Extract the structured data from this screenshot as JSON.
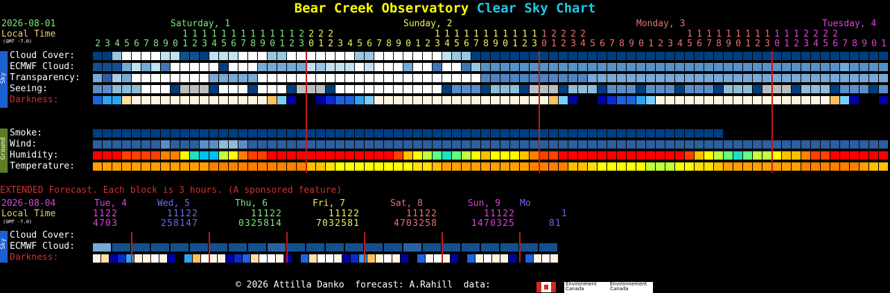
{
  "header": {
    "title_part1": "Bear Creek Observatory",
    "title_part2": "Clear Sky Chart",
    "title_color1": "#ffff00",
    "title_color2": "#1fc8e8",
    "date": "2026-08-01",
    "local_time_label": "Local Time",
    "gmt_label": "(GMT -7.0)",
    "days": [
      {
        "label": "Saturday, 1",
        "color": "#7ee87e"
      },
      {
        "label": "Sunday, 2",
        "color": "#f0f060"
      },
      {
        "label": "Monday, 3",
        "color": "#f07070"
      },
      {
        "label": "Tuesday, 4",
        "color": "#e040e0"
      }
    ]
  },
  "rows": {
    "sky_label": "Sky",
    "ground_label": "Ground",
    "cloud_cover": "Cloud Cover:",
    "ecmwf_cloud": "ECMWF Cloud:",
    "transparency": "Transparency:",
    "seeing": "Seeing:",
    "darkness": "Darkness:",
    "smoke": "Smoke:",
    "wind": "Wind:",
    "humidity": "Humidity:",
    "temperature": "Temperature:"
  },
  "extended": {
    "banner": "EXTENDED Forecast. Each block is 3 hours. (A sponsored feature)",
    "date": "2026-08-04",
    "local_time_label": "Local Time",
    "gmt_label": "(GMT -7.0)",
    "days": [
      {
        "label": "Tue, 4",
        "color": "#e040e0",
        "tens": "1122 ",
        "ones": "4703"
      },
      {
        "label": "Wed, 5",
        "color": "#6a6af0",
        "tens": " 11122",
        "ones": "258147"
      },
      {
        "label": "Thu, 6",
        "color": "#7ee87e",
        "tens": "  11122",
        "ones": "0325814"
      },
      {
        "label": "Fri, 7",
        "color": "#f0f060",
        "tens": "  11122",
        "ones": "7032581"
      },
      {
        "label": "Sat, 8",
        "color": "#f07070",
        "tens": "  11122",
        "ones": "4703258"
      },
      {
        "label": "Sun, 9",
        "color": "#e040e0",
        "tens": "  11122",
        "ones": "1470325"
      },
      {
        "label": "Mo",
        "color": "#6a6af0",
        "tens": "  1",
        "ones": "81"
      }
    ],
    "cloud_cover": "Cloud Cover:",
    "ecmwf_cloud": "ECMWF Cloud:",
    "darkness": "Darkness:"
  },
  "footer": {
    "text": "© 2026 Attilla Danko  forecast: A.Rahill  data:",
    "env_line1": "Environment",
    "env_line2": "Canada",
    "env_line3": "Environnement",
    "env_line4": "Canada"
  },
  "chart_data": {
    "type": "heatmap",
    "title": "Bear Creek Observatory Clear Sky Chart",
    "start_hour": 2,
    "hour_tens": "         1111111111112222          1111111111112222          1111111111112222          11",
    "hour_ones": "23456789012345678901230123456789012345678901230123456789012345678901230123456789012345678901",
    "palette": {
      "cloud": [
        "#003f7f",
        "#13508d",
        "#2a62a0",
        "#4077b4",
        "#5891c6",
        "#75aad6",
        "#9ac6e0",
        "#c2e2f0",
        "#ffffff"
      ],
      "transparency": [
        "#003f7f",
        "#2c5ea0",
        "#4d84c0",
        "#79a9d6",
        "#a8cce8",
        "#d6ecf6",
        "#ffffff"
      ],
      "seeing": [
        "#003f7f",
        "#2c5ea0",
        "#5a8dc8",
        "#8fbcd8",
        "#bdbdbd",
        "#ffffff"
      ],
      "darkness": [
        "#000000",
        "#0000a0",
        "#0a2ad0",
        "#1e62e0",
        "#2fa4f0",
        "#78d0ff",
        "#ffe0a0",
        "#ffc060",
        "#fff4e0",
        "#ffffff"
      ],
      "smoke": [
        "#003f7f"
      ],
      "wind": [
        "#003f7f",
        "#2c5ea0",
        "#5a8dc8",
        "#8fbcd8"
      ],
      "humidity": [
        "#ff0000",
        "#ff4000",
        "#ff8000",
        "#ffc000",
        "#ffff00",
        "#c0ff40",
        "#60ff80",
        "#20e0c0",
        "#00c0ff"
      ],
      "temperature": [
        "#ff6000",
        "#ff8000",
        "#ffa000",
        "#ffc000",
        "#ffe000",
        "#ffff00",
        "#c0ff40",
        "#80ff60"
      ]
    },
    "series": {
      "cloud_cover": [
        0,
        0,
        6,
        8,
        8,
        8,
        8,
        7,
        7,
        1,
        1,
        0,
        7,
        7,
        7,
        8,
        8,
        8,
        6,
        6,
        8,
        8,
        8,
        8,
        8,
        8,
        8,
        6,
        6,
        8,
        8,
        8,
        8,
        8,
        8,
        8,
        7,
        6,
        6,
        0,
        0,
        0,
        0,
        0,
        0,
        0,
        0,
        0,
        0,
        0,
        0,
        0,
        0,
        0,
        0,
        0,
        0,
        0,
        0,
        0,
        0,
        0,
        0,
        0,
        0,
        0,
        0,
        0,
        0,
        0,
        0,
        0,
        0,
        0,
        0,
        0,
        0,
        0,
        0,
        0,
        0,
        0,
        0,
        0,
        0,
        0,
        0,
        0,
        0,
        0,
        0
      ],
      "ecmwf_cloud": [
        1,
        1,
        1,
        5,
        7,
        5,
        7,
        3,
        8,
        8,
        8,
        8,
        8,
        0,
        8,
        8,
        8,
        5,
        5,
        5,
        5,
        5,
        7,
        6,
        7,
        7,
        7,
        8,
        7,
        8,
        8,
        8,
        5,
        8,
        8,
        3,
        8,
        8,
        3,
        6,
        4,
        4,
        4,
        4,
        4,
        4,
        4,
        4,
        4,
        4,
        4,
        4,
        4,
        4,
        4,
        4,
        4,
        4,
        4,
        4,
        4,
        4,
        4,
        4,
        4,
        4,
        4,
        4,
        4,
        4,
        4,
        4,
        4,
        4,
        4,
        4,
        4,
        5,
        4,
        4,
        4,
        4,
        4,
        4,
        4,
        4,
        4,
        4,
        4,
        4,
        3
      ],
      "transparency": [
        3,
        1,
        4,
        3,
        6,
        6,
        6,
        6,
        6,
        6,
        6,
        6,
        3,
        3,
        3,
        3,
        3,
        6,
        6,
        6,
        6,
        6,
        6,
        6,
        6,
        6,
        6,
        6,
        6,
        6,
        6,
        6,
        6,
        6,
        6,
        6,
        6,
        6,
        6,
        6,
        2,
        2,
        2,
        2,
        2,
        2,
        2,
        2,
        2,
        2,
        2,
        3,
        3,
        3,
        3,
        3,
        3,
        3,
        3,
        3,
        3,
        3,
        3,
        3,
        3,
        3,
        3,
        3,
        3,
        3,
        3,
        3,
        3,
        3,
        3,
        3,
        3,
        3,
        3,
        3,
        3,
        3,
        3,
        3,
        3,
        3,
        3,
        3,
        3,
        3,
        3
      ],
      "seeing": [
        2,
        2,
        3,
        3,
        3,
        5,
        5,
        5,
        0,
        4,
        4,
        4,
        0,
        5,
        5,
        5,
        0,
        5,
        5,
        5,
        0,
        4,
        4,
        4,
        0,
        5,
        5,
        5,
        5,
        5,
        5,
        5,
        5,
        5,
        5,
        5,
        0,
        2,
        2,
        2,
        0,
        3,
        3,
        3,
        0,
        4,
        4,
        4,
        0,
        3,
        3,
        3,
        0,
        2,
        2,
        2,
        0,
        2,
        2,
        2,
        0,
        2,
        2,
        2,
        0,
        3,
        3,
        3,
        0,
        4,
        4,
        4,
        0,
        3,
        3,
        3,
        0,
        2,
        2,
        2,
        0,
        2,
        2,
        2,
        0,
        1,
        1,
        1,
        0,
        2,
        2
      ],
      "darkness": [
        3,
        4,
        4,
        6,
        8,
        8,
        8,
        8,
        8,
        8,
        8,
        8,
        8,
        8,
        8,
        8,
        8,
        8,
        7,
        5,
        1,
        0,
        0,
        1,
        2,
        3,
        3,
        4,
        5,
        8,
        8,
        8,
        8,
        8,
        8,
        8,
        8,
        8,
        8,
        8,
        8,
        8,
        8,
        8,
        8,
        8,
        8,
        7,
        5,
        1,
        0,
        0,
        1,
        2,
        3,
        3,
        4,
        5,
        8,
        8,
        8,
        8,
        8,
        8,
        8,
        8,
        8,
        8,
        8,
        8,
        8,
        8,
        8,
        8,
        8,
        8,
        7,
        5,
        1,
        0,
        0,
        1,
        2,
        3,
        3,
        4,
        5,
        8,
        8,
        8,
        8
      ],
      "smoke": [
        0,
        0,
        0,
        0,
        0,
        0,
        0,
        0,
        0,
        0,
        0,
        0,
        0,
        0,
        0,
        0,
        0,
        0,
        0,
        0,
        0,
        0,
        0,
        0,
        0,
        0,
        0,
        0,
        0,
        0,
        0,
        0,
        0,
        0,
        0,
        0,
        0,
        0,
        0,
        0,
        0,
        0,
        0,
        0,
        0,
        0,
        0,
        0,
        0,
        0,
        0,
        0,
        0,
        0,
        0,
        0,
        0,
        0,
        0,
        0,
        0,
        0,
        0,
        0,
        0
      ],
      "wind": [
        1,
        1,
        1,
        1,
        1,
        1,
        1,
        2,
        1,
        1,
        1,
        2,
        2,
        3,
        3,
        2,
        1,
        1,
        1,
        1,
        1,
        1,
        1,
        1,
        1,
        1,
        1,
        1,
        1,
        1,
        1,
        1,
        1,
        1,
        1,
        1,
        1,
        1,
        1,
        1,
        1,
        1,
        1,
        1,
        1,
        1,
        1,
        1,
        1,
        1,
        1,
        1,
        1,
        1,
        1,
        1,
        1,
        1,
        1,
        1,
        1,
        1,
        1,
        1,
        1,
        1,
        1,
        1,
        1,
        1,
        1,
        1,
        1,
        1,
        1,
        1,
        1,
        1,
        1,
        1,
        1,
        1,
        1,
        1,
        1,
        1,
        0,
        0,
        0,
        0,
        0
      ],
      "humidity": [
        0,
        0,
        0,
        1,
        1,
        1,
        1,
        2,
        2,
        4,
        7,
        8,
        8,
        5,
        4,
        2,
        1,
        1,
        0,
        0,
        0,
        0,
        0,
        0,
        0,
        0,
        0,
        0,
        0,
        0,
        0,
        1,
        3,
        4,
        5,
        6,
        7,
        6,
        5,
        4,
        3,
        4,
        4,
        4,
        3,
        2,
        1,
        1,
        0,
        0,
        0,
        0,
        0,
        0,
        0,
        0,
        0,
        0,
        0,
        0,
        0,
        1,
        3,
        4,
        5,
        6,
        7,
        6,
        5,
        5,
        4,
        3,
        3,
        2,
        1,
        1,
        0,
        0,
        0,
        0,
        0,
        0,
        0,
        0,
        0,
        0,
        0,
        0,
        0,
        0,
        4
      ],
      "temperature": [
        2,
        2,
        2,
        2,
        2,
        2,
        2,
        2,
        2,
        2,
        2,
        2,
        1,
        1,
        1,
        1,
        1,
        1,
        1,
        1,
        1,
        1,
        3,
        3,
        4,
        5,
        5,
        5,
        5,
        5,
        5,
        5,
        5,
        4,
        4,
        3,
        2,
        2,
        2,
        2,
        2,
        2,
        2,
        2,
        2,
        1,
        1,
        1,
        1,
        3,
        3,
        4,
        5,
        5,
        5,
        5,
        5,
        6,
        6,
        6,
        5,
        5,
        4,
        4,
        3,
        2,
        2,
        2,
        2,
        2,
        2,
        2,
        2,
        1,
        1,
        1,
        1,
        1,
        1,
        2,
        3,
        3,
        4,
        5,
        5,
        5,
        5,
        5,
        4,
        3,
        3
      ]
    },
    "extended": {
      "cloud_cover": [
        5,
        0,
        0,
        0,
        0,
        0,
        0,
        0,
        0,
        0,
        0,
        0,
        0,
        0,
        0,
        0,
        0,
        0,
        0,
        0,
        0,
        0,
        0,
        0,
        0,
        0,
        0,
        0,
        0,
        0,
        0,
        0,
        0,
        0,
        0,
        0,
        0,
        0,
        0,
        0,
        0,
        0,
        0,
        0,
        0,
        0,
        0,
        0,
        0,
        0,
        0,
        0,
        0,
        0,
        0
      ],
      "ecmwf_cloud": [
        5,
        1,
        1,
        1,
        1,
        1,
        1,
        1,
        1,
        2,
        1,
        1,
        1,
        1,
        1,
        1,
        2,
        1,
        1,
        1,
        1,
        1,
        1,
        1,
        1,
        1,
        1,
        1,
        1,
        1,
        1,
        1,
        1,
        1,
        1,
        1,
        1,
        1,
        1,
        1,
        1,
        1,
        1,
        1,
        1,
        1,
        1,
        1,
        1,
        1,
        1,
        1,
        1,
        6,
        6,
        1,
        1,
        1,
        1
      ],
      "darkness": [
        8,
        6,
        1,
        2,
        4,
        8,
        8,
        9,
        8,
        1,
        0,
        4,
        7,
        9,
        8,
        8,
        1,
        2,
        3,
        6,
        9,
        9,
        8,
        1,
        0,
        3,
        6,
        9,
        9,
        8,
        1,
        2,
        4,
        7,
        8,
        9,
        8,
        1,
        0,
        3,
        8,
        9,
        8,
        1,
        0,
        3,
        8,
        9,
        8,
        8,
        1,
        0,
        3,
        8,
        9,
        8,
        9
      ]
    }
  }
}
